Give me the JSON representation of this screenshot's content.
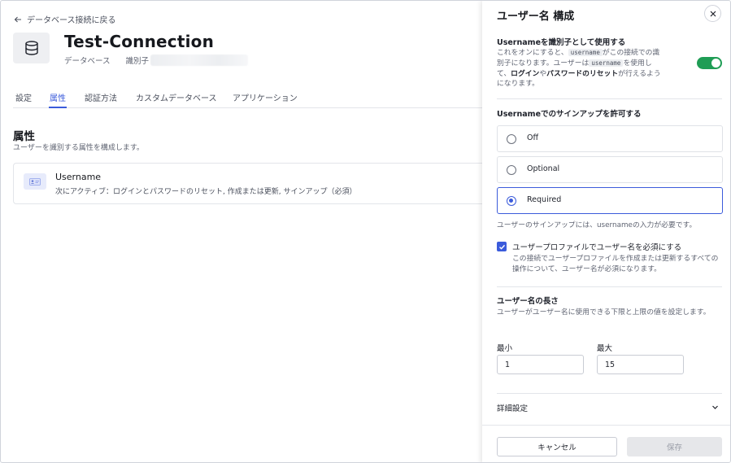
{
  "page": {
    "back_link": "データベース接続に戻る",
    "connection_name": "Test-Connection",
    "meta_type": "データベース",
    "meta_id_label": "識別子",
    "tabs": [
      {
        "label": "設定",
        "active": false
      },
      {
        "label": "属性",
        "active": true
      },
      {
        "label": "認証方法",
        "active": false
      },
      {
        "label": "カスタムデータベース",
        "active": false
      },
      {
        "label": "アプリケーション",
        "active": false
      }
    ],
    "section_title": "属性",
    "section_subtitle": "ユーザーを識別する属性を構成します。",
    "attribute": {
      "name": "Username",
      "description": "次にアクティブ：ログインとパスワードのリセット, 作成または更新, サインアップ（必須）"
    }
  },
  "panel": {
    "title": "ユーザー名 構成",
    "identifier_title": "Usernameを識別子として使用する",
    "identifier_desc": {
      "p1": "これをオンにすると、",
      "code1": "username",
      "p2": "がこの接続での識別子になります。ユーザーは",
      "code2": "username",
      "p3": "を使用して、",
      "b1": "ログイン",
      "p4": "や",
      "b2": "パスワードのリセット",
      "p5": "が行えるようになります。"
    },
    "identifier_toggle_on": true,
    "signup_title": "Usernameでのサインアップを許可する",
    "signup_options": [
      {
        "label": "Off",
        "selected": false
      },
      {
        "label": "Optional",
        "selected": false
      },
      {
        "label": "Required",
        "selected": true
      }
    ],
    "required_note": "ユーザーのサインアップには、usernameの入力が必要です。",
    "profile_required_label": "ユーザープロファイルでユーザー名を必須にする",
    "profile_required_desc": "この接続でユーザープロファイルを作成または更新するすべての操作について、ユーザー名が必須になります。",
    "profile_required_checked": true,
    "length_title": "ユーザー名の長さ",
    "length_desc": "ユーザーがユーザー名に使用できる下限と上限の値を設定します。",
    "min_label": "最小",
    "min_value": "1",
    "max_label": "最大",
    "max_value": "15",
    "advanced_label": "詳細設定",
    "cancel_label": "キャンセル",
    "save_label": "保存"
  },
  "colors": {
    "accent": "#3b5bdb",
    "toggle_on": "#1f9d55",
    "disabled_bg": "#e6e7ea"
  }
}
